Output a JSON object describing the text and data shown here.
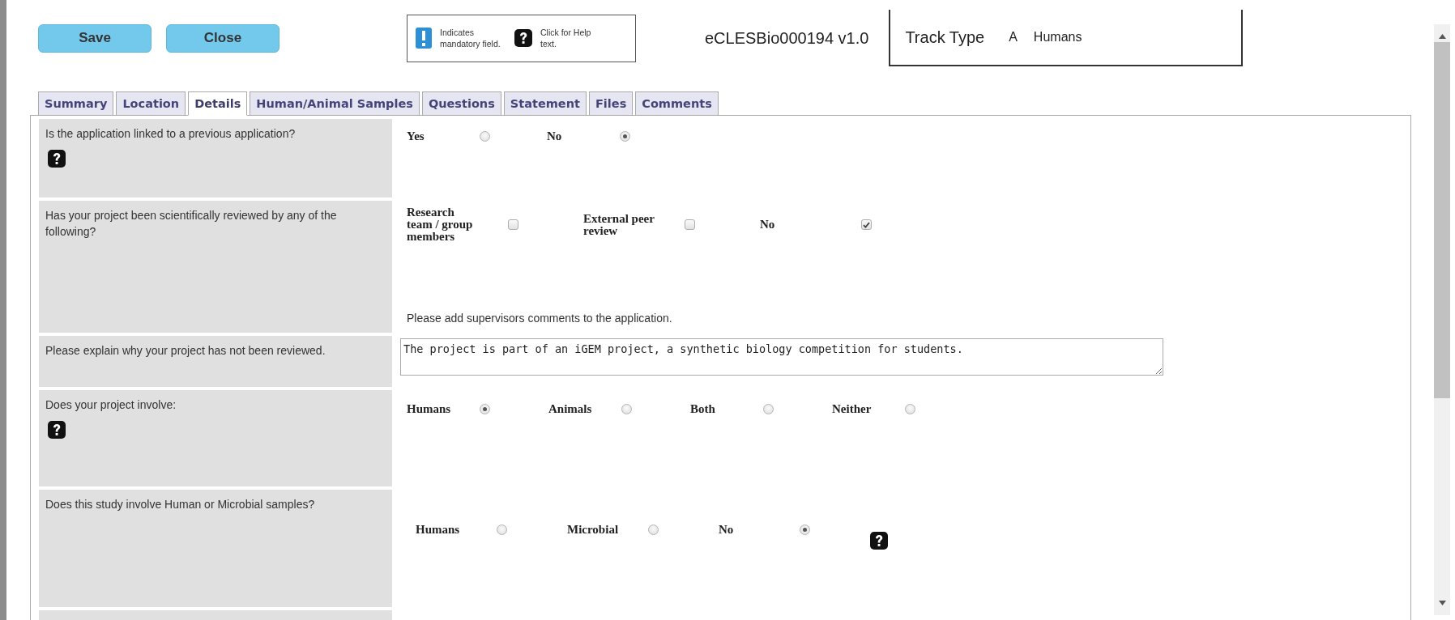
{
  "toolbar": {
    "buttons": [
      {
        "label": "Save"
      },
      {
        "label": "Close"
      }
    ]
  },
  "legend": {
    "mandatory": "Indicates mandatory field.",
    "help": "Click for Help text."
  },
  "record_id": "eCLESBio000194 v1.0",
  "track_type": {
    "label": "Track Type",
    "code": "A",
    "value": "Humans"
  },
  "tabs": [
    {
      "label": "Summary",
      "selected": false
    },
    {
      "label": "Location",
      "selected": false
    },
    {
      "label": "Details",
      "selected": true
    },
    {
      "label": "Human/Animal Samples",
      "selected": false
    },
    {
      "label": "Questions",
      "selected": false
    },
    {
      "label": "Statement",
      "selected": false
    },
    {
      "label": "Files",
      "selected": false
    },
    {
      "label": "Comments",
      "selected": false
    }
  ],
  "rows": [
    {
      "question": "Is the application linked to a previous application?",
      "label_help": true,
      "kind": "radio",
      "options": [
        {
          "label": "Yes",
          "selected": false
        },
        {
          "label": "No",
          "selected": true
        }
      ]
    },
    {
      "question": "Has your project been scientifically reviewed by any of the following?",
      "kind": "checkbox",
      "options": [
        {
          "label": "Research team / group members",
          "checked": false
        },
        {
          "label": "External peer review",
          "checked": false
        },
        {
          "label": "No",
          "checked": true
        }
      ],
      "note": "Please add supervisors comments to the application."
    },
    {
      "question": "Please explain why your project has not been reviewed.",
      "kind": "textarea",
      "value": "The project is part of an iGEM project, a synthetic biology competition for students."
    },
    {
      "question": "Does your project involve:",
      "label_help": true,
      "kind": "radio",
      "options": [
        {
          "label": "Humans",
          "selected": true
        },
        {
          "label": "Animals",
          "selected": false
        },
        {
          "label": "Both",
          "selected": false
        },
        {
          "label": "Neither",
          "selected": false
        }
      ]
    },
    {
      "question": "Does this study involve Human or Microbial samples?",
      "answer_help": true,
      "kind": "radio",
      "options": [
        {
          "label": "Humans",
          "selected": false
        },
        {
          "label": "Microbial",
          "selected": false
        },
        {
          "label": "No",
          "selected": true
        }
      ]
    }
  ]
}
